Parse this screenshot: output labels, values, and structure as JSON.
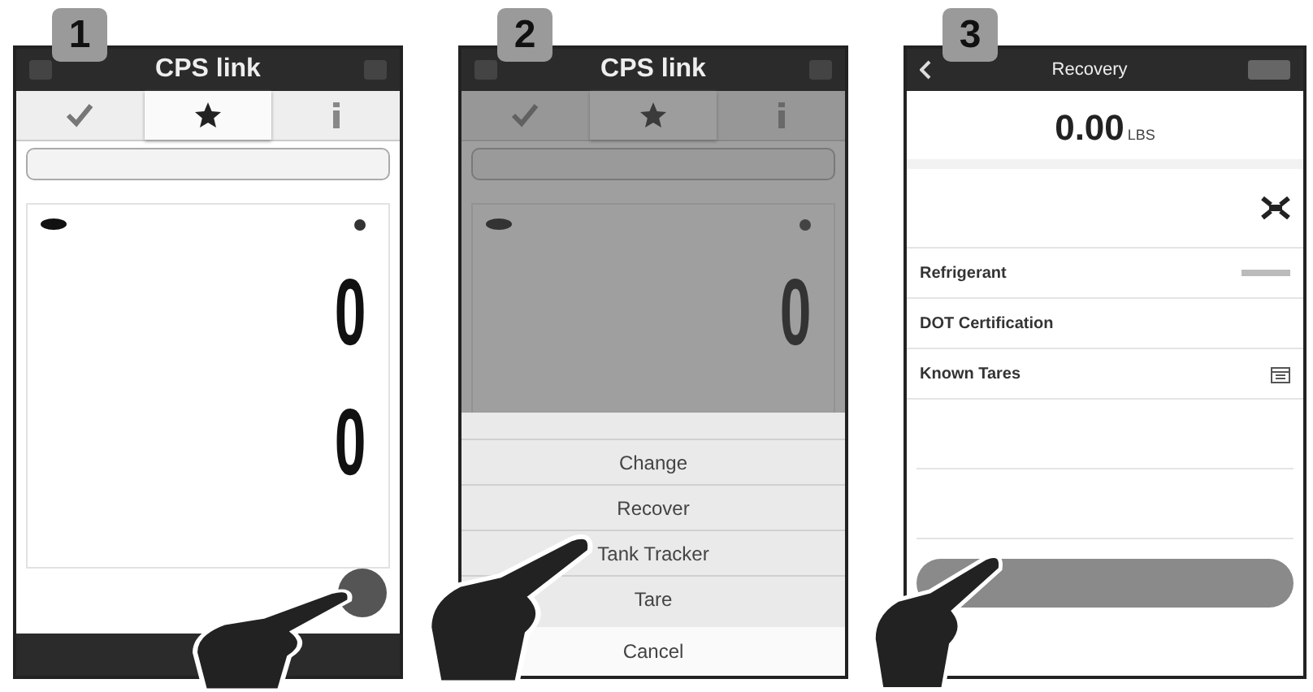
{
  "steps": [
    {
      "number": "1",
      "kind": "home",
      "title": "CPS link",
      "tabs": [
        {
          "kind": "check",
          "selected": false
        },
        {
          "kind": "star",
          "selected": true
        },
        {
          "kind": "info",
          "selected": false
        }
      ],
      "readings": [
        "0",
        "0"
      ]
    },
    {
      "number": "2",
      "kind": "menu",
      "title": "CPS link",
      "tabs": [
        {
          "kind": "check",
          "selected": false
        },
        {
          "kind": "star",
          "selected": true
        },
        {
          "kind": "info",
          "selected": false
        }
      ],
      "readings": [
        "0"
      ],
      "menu": {
        "options": [
          "Change",
          "Recover",
          "Tank Tracker",
          "Tare"
        ],
        "cancel": "Cancel"
      }
    },
    {
      "number": "3",
      "kind": "form",
      "title": "Recovery",
      "weight": "0.00",
      "unit": "LBS",
      "rows": [
        {
          "label": "Refrigerant"
        },
        {
          "label": "DOT Certification"
        },
        {
          "label": "Known Tares"
        }
      ]
    }
  ]
}
